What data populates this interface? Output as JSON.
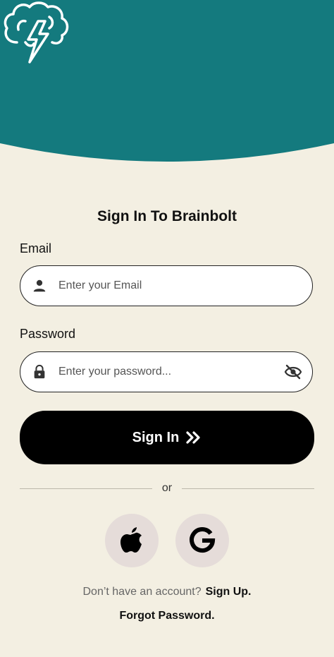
{
  "colors": {
    "header": "#147a7e",
    "background": "#f3efe2",
    "button": "#000000",
    "social_bg": "#e5dcd9"
  },
  "header": {
    "logo_icon": "brain-lightning-icon"
  },
  "title": "Sign In To Brainbolt",
  "email": {
    "label": "Email",
    "placeholder": "Enter your Email",
    "icon": "person-icon"
  },
  "password": {
    "label": "Password",
    "placeholder": "Enter your password...",
    "icon": "lock-icon",
    "toggle_icon": "eye-off-icon"
  },
  "signin_button": {
    "label": "Sign In",
    "icon": "double-chevron-right-icon"
  },
  "divider_text": "or",
  "social": [
    {
      "icon": "apple-icon"
    },
    {
      "icon": "google-icon"
    }
  ],
  "signup": {
    "prompt": "Don’t have an account?",
    "link": "Sign Up."
  },
  "forgot_password": "Forgot Password."
}
